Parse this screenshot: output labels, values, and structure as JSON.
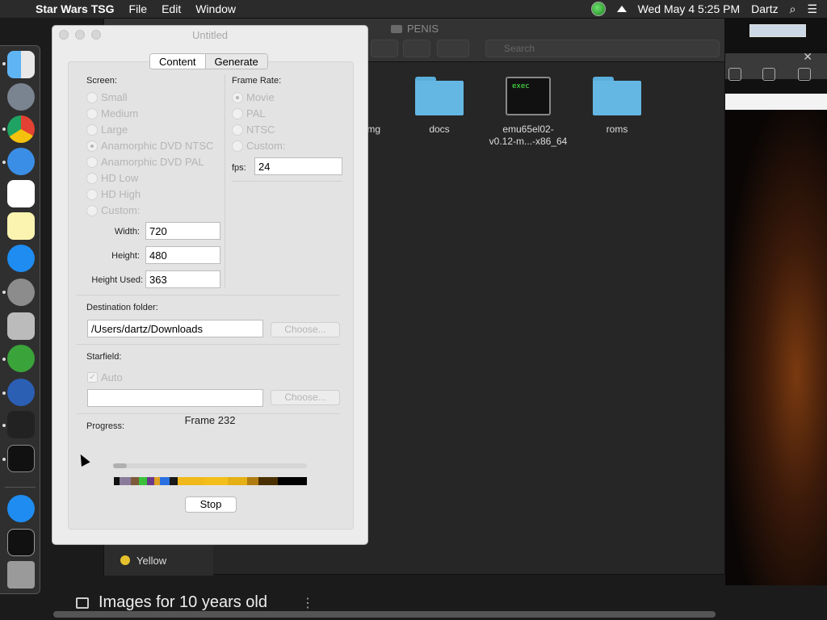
{
  "menubar": {
    "apple_glyph": "",
    "app_name": "Star Wars TSG",
    "items": [
      "File",
      "Edit",
      "Window"
    ],
    "clock": "Wed May 4  5:25 PM",
    "user": "Dartz",
    "search_glyph": "⌕",
    "menu_glyph": "☰"
  },
  "finder": {
    "title": "PENIS",
    "search_placeholder": "Search",
    "files": [
      {
        "name": "img"
      },
      {
        "name": "docs"
      },
      {
        "name": "emu65el02-\nv0.12-m...-x86_64",
        "line1": "emu65el02-",
        "line2": "v0.12-m...-x86_64",
        "badge": "exec"
      },
      {
        "name": "roms"
      }
    ],
    "sidebar_tag": "Yellow"
  },
  "browser": {
    "close": "✕"
  },
  "bottom": {
    "label": "Images for 10 years old",
    "kebab": "⋮"
  },
  "dialog": {
    "title": "Untitled",
    "tabs": [
      "Content",
      "Generate"
    ],
    "screen": {
      "label": "Screen:",
      "options": [
        "Small",
        "Medium",
        "Large",
        "Anamorphic DVD NTSC",
        "Anamorphic DVD PAL",
        "HD Low",
        "HD High",
        "Custom:"
      ],
      "selected": "Anamorphic DVD NTSC",
      "width_label": "Width:",
      "width_value": "720",
      "height_label": "Height:",
      "height_value": "480",
      "height_used_label": "Height Used:",
      "height_used_value": "363"
    },
    "frame_rate": {
      "label": "Frame Rate:",
      "options": [
        "Movie",
        "PAL",
        "NTSC",
        "Custom:"
      ],
      "selected": "Movie",
      "fps_label": "fps:",
      "fps_value": "24"
    },
    "destination": {
      "label": "Destination folder:",
      "value": "/Users/dartz/Downloads",
      "choose": "Choose..."
    },
    "starfield": {
      "label": "Starfield:",
      "auto_label": "Auto",
      "auto_checked": true,
      "value": "",
      "choose": "Choose..."
    },
    "progress": {
      "label": "Progress:",
      "frame_text": "Frame 232",
      "fraction": 0.07,
      "stop": "Stop",
      "strip_colors": [
        "#111111",
        "#8a7a9a",
        "#7d5a3a",
        "#3ac03a",
        "#6a3a8a",
        "#e0a020",
        "#2a70e0",
        "#1a1a1a",
        "#f0b818",
        "#f3be1a",
        "#e5b015",
        "#b07c10",
        "#4a3000",
        "#000000"
      ]
    }
  }
}
